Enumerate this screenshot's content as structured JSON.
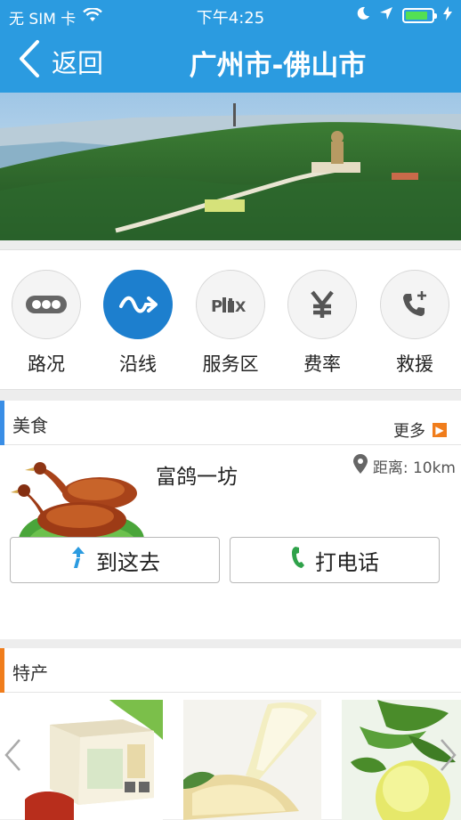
{
  "status": {
    "carrier": "无 SIM 卡",
    "time": "下午4:25"
  },
  "nav": {
    "back_label": "返回",
    "title": "广州市-佛山市"
  },
  "menu": [
    {
      "label": "路况",
      "icon": "traffic-dots-icon"
    },
    {
      "label": "沿线",
      "icon": "route-wave-icon",
      "active": true
    },
    {
      "label": "服务区",
      "icon": "service-area-icon"
    },
    {
      "label": "费率",
      "icon": "yuan-icon"
    },
    {
      "label": "救援",
      "icon": "phone-plus-icon"
    }
  ],
  "food": {
    "title": "美食",
    "more_label": "更多",
    "item_name": "富鸽一坊",
    "distance": "距离: 10km",
    "goto_label": "到这去",
    "call_label": "打电话"
  },
  "specialty": {
    "title": "特产"
  },
  "colors": {
    "primary": "#2b9be0",
    "active_circle": "#1d7fce",
    "food_accent": "#3a8ee6",
    "specialty_accent": "#f07d1c",
    "more_badge": "#f07d1c"
  }
}
